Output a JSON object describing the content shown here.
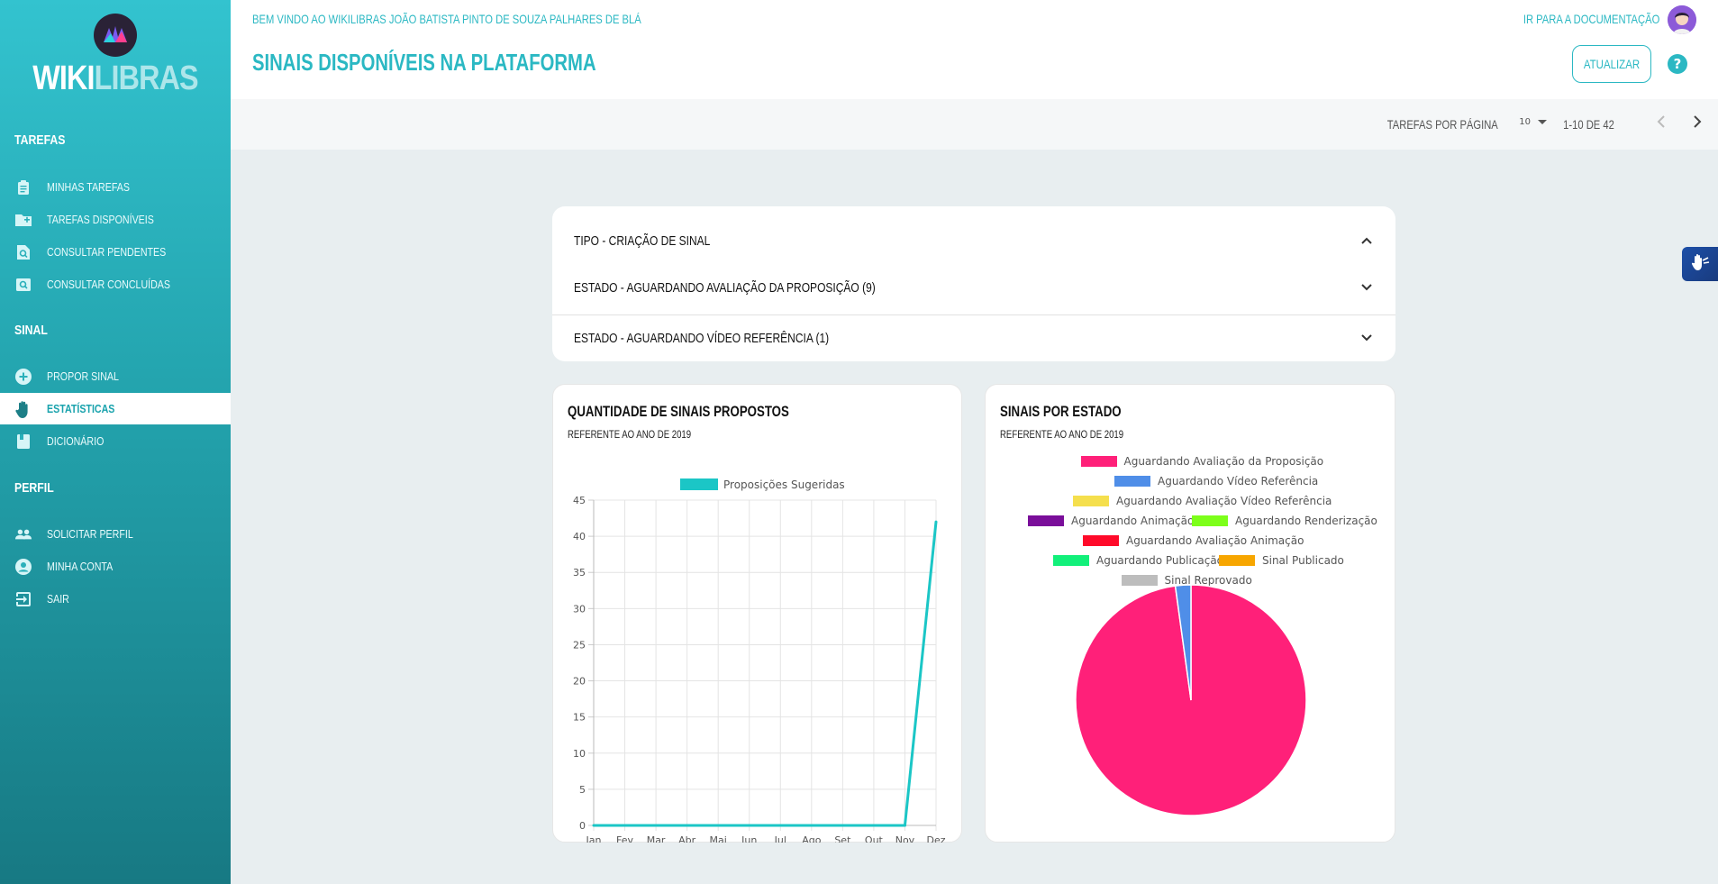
{
  "app": {
    "logo_main": "WIKI",
    "logo_accent": "LIBRAS"
  },
  "sidebar": {
    "sections": [
      {
        "label": "Tarefas",
        "items": [
          {
            "label": "Minhas Tarefas",
            "icon": "clipboard-icon"
          },
          {
            "label": "Tarefas Disponíveis",
            "icon": "folder-add-icon"
          },
          {
            "label": "Consultar Pendentes",
            "icon": "search-document-icon"
          },
          {
            "label": "Consultar Concluídas",
            "icon": "search-photo-icon"
          }
        ]
      },
      {
        "label": "Sinal",
        "items": [
          {
            "label": "Propor Sinal",
            "icon": "add-circle-icon"
          },
          {
            "label": "Estatísticas",
            "icon": "hand-icon",
            "active": true
          },
          {
            "label": "Dicionário",
            "icon": "book-icon"
          }
        ]
      },
      {
        "label": "Perfil",
        "items": [
          {
            "label": "Solicitar Perfil",
            "icon": "people-icon"
          },
          {
            "label": "Minha Conta",
            "icon": "account-circle-icon"
          },
          {
            "label": "Sair",
            "icon": "exit-icon"
          }
        ]
      }
    ]
  },
  "header": {
    "welcome": "Bem vindo ao WikiLibras João Batista Pinto de Souza Palhares de Blá",
    "title": "Sinais disponíveis na plataforma",
    "doc_link": "Ir para a documentação",
    "refresh_label": "Atualizar",
    "help": "?"
  },
  "pagination": {
    "per_page_label": "Tarefas por página",
    "per_page_value": "10",
    "range": "1-10 de 42"
  },
  "accordion": {
    "type_title": "Tipo - Criação de Sinal",
    "rows": [
      "Estado - Aguardando Avaliação da Proposição (9)",
      "Estado - Aguardando Vídeo Referência (1)"
    ]
  },
  "charts": {
    "line_card": {
      "title": "Quantidade de sinais propostos",
      "subtitle": "Referente ao ano de 2019"
    },
    "pie_card": {
      "title": "Sinais por estado",
      "subtitle": "Referente ao ano de 2019"
    }
  },
  "chart_data": [
    {
      "type": "line",
      "title": "Quantidade de sinais propostos",
      "subtitle": "Referente ao ano de 2019",
      "x": [
        "Jan",
        "Fev",
        "Mar",
        "Abr",
        "Mai",
        "Jun",
        "Jul",
        "Ago",
        "Set",
        "Out",
        "Nov",
        "Dez"
      ],
      "series": [
        {
          "name": "Proposições Sugeridas",
          "color": "#1bc6c6",
          "values": [
            0,
            0,
            0,
            0,
            0,
            0,
            0,
            0,
            0,
            0,
            0,
            42
          ]
        }
      ],
      "ylim": [
        0,
        45
      ],
      "yticks": [
        0,
        5,
        10,
        15,
        20,
        25,
        30,
        35,
        40,
        45
      ],
      "grid": true,
      "legend": "top"
    },
    {
      "type": "pie",
      "title": "Sinais por estado",
      "subtitle": "Referente ao ano de 2019",
      "legend": "top",
      "slices": [
        {
          "name": "Aguardando Avaliação da Proposição",
          "value": 9,
          "color": "#ff2079"
        },
        {
          "name": "Aguardando Vídeo Referência",
          "value": 0.2,
          "color": "#4f8ee8"
        },
        {
          "name": "Aguardando Avaliação Vídeo Referência",
          "value": 0,
          "color": "#f5df4d"
        },
        {
          "name": "Aguardando Animação",
          "value": 0,
          "color": "#7a0e9a"
        },
        {
          "name": "Aguardando Renderização",
          "value": 0,
          "color": "#7dff1a"
        },
        {
          "name": "Aguardando Avaliação Animação",
          "value": 0,
          "color": "#ff0a2a"
        },
        {
          "name": "Aguardando Publicação",
          "value": 0,
          "color": "#12f07a"
        },
        {
          "name": "Sinal Publicado",
          "value": 0,
          "color": "#f7a600"
        },
        {
          "name": "Sinal Reprovado",
          "value": 0,
          "color": "#bdbdbd"
        }
      ]
    }
  ]
}
